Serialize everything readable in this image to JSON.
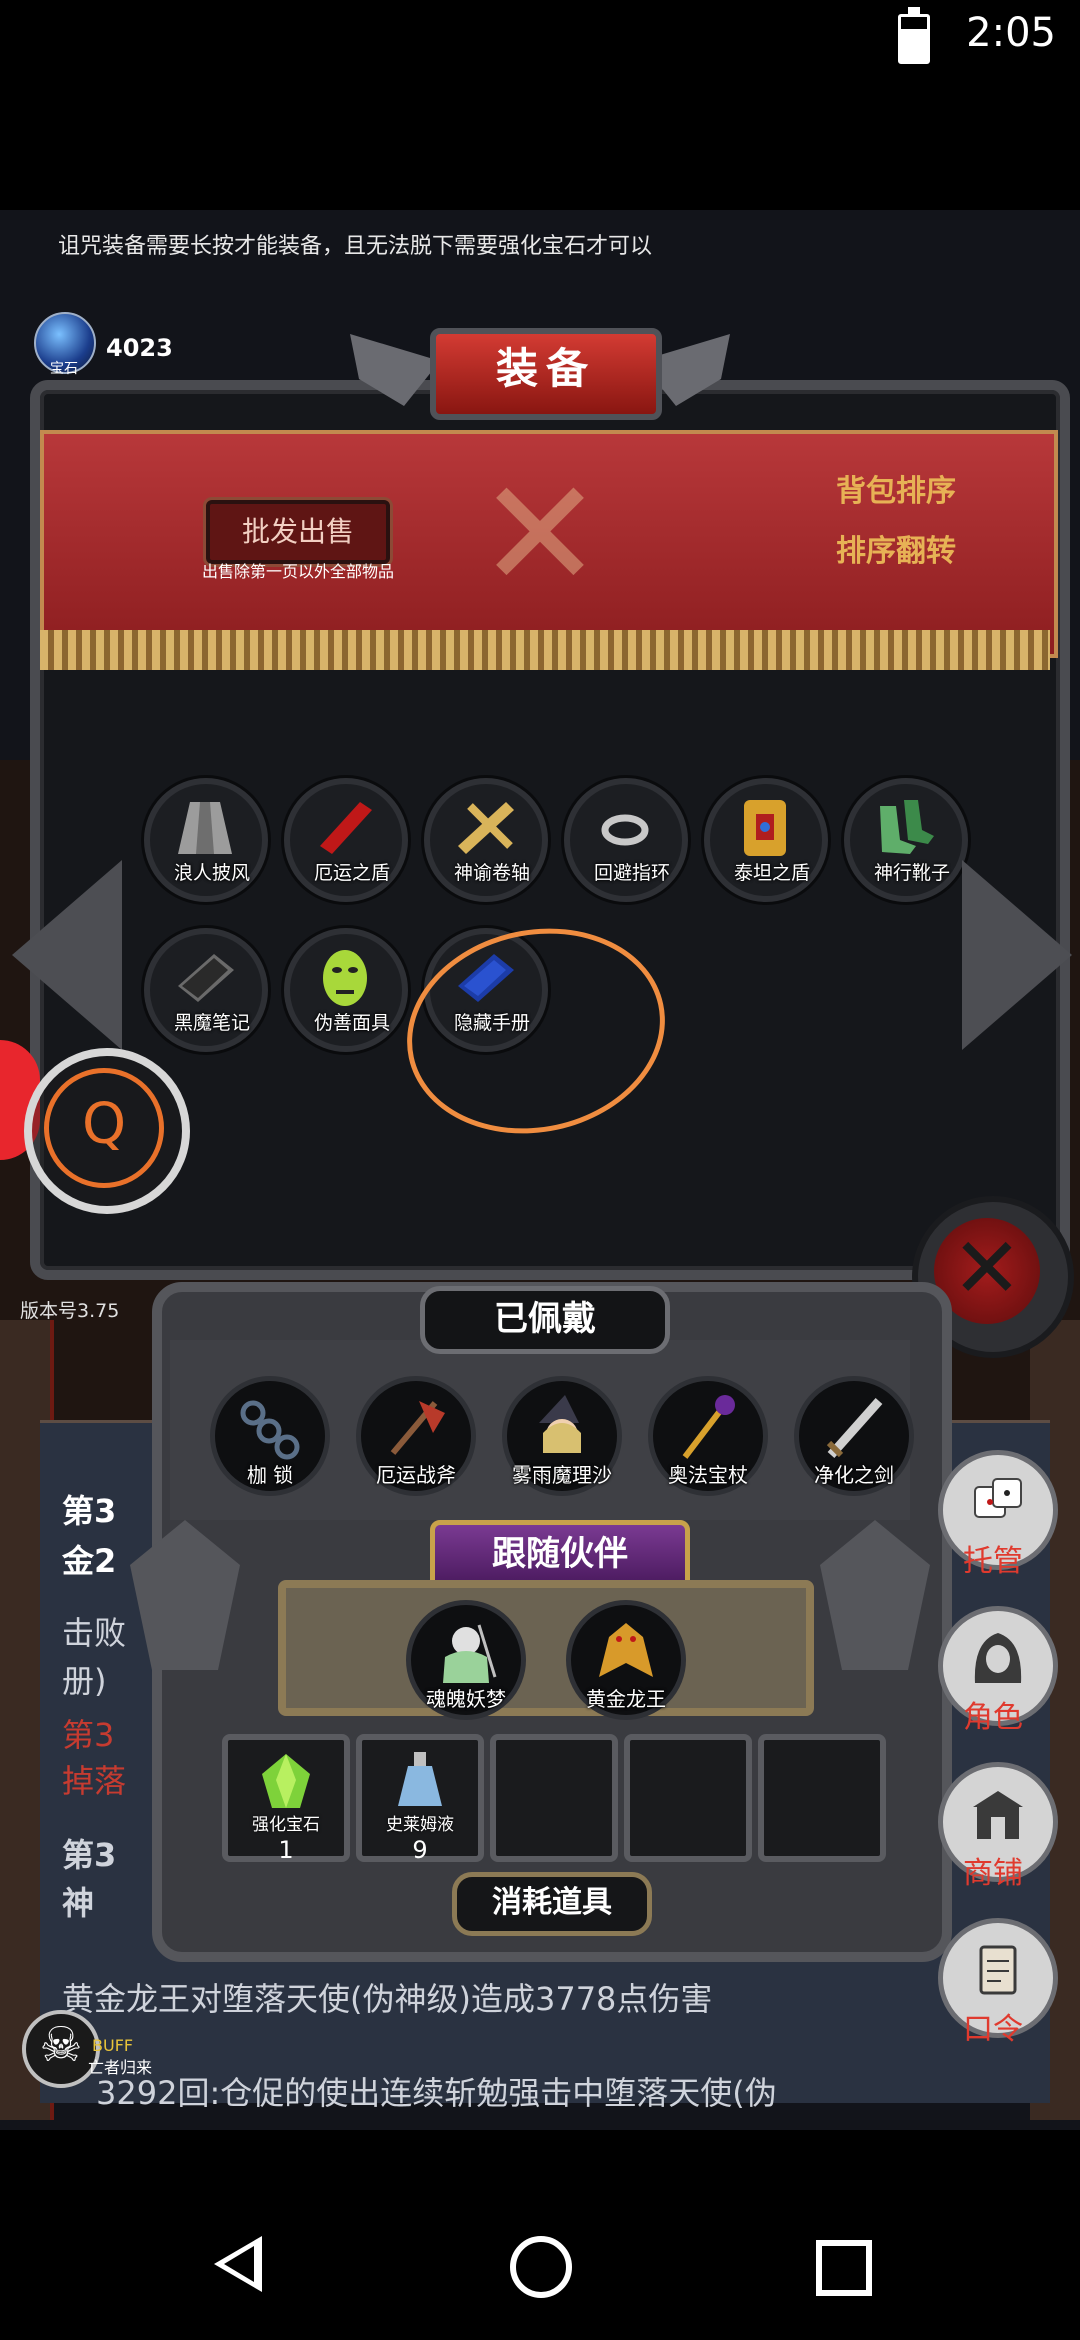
{
  "status_bar": {
    "time": "2:05",
    "battery_icon": "battery-icon"
  },
  "hint_text": "诅咒装备需要长按才能装备，且无法脱下需要强化宝石才可以",
  "currency": {
    "sub_label": "宝石",
    "count": "4023"
  },
  "equipment": {
    "title": "装备",
    "bulk_sell": "批发出售",
    "bulk_sell_note": "出售除第一页以外全部物品",
    "sort_bag": "背包排序",
    "sort_flip": "排序翻转",
    "items": [
      {
        "label": "浪人披风",
        "icon": "cloak-icon",
        "color": "#9c9c9c"
      },
      {
        "label": "厄运之盾",
        "icon": "red-shield-icon",
        "color": "#c01818"
      },
      {
        "label": "神谕卷轴",
        "icon": "scroll-icon",
        "color": "#d9b45a"
      },
      {
        "label": "回避指环",
        "icon": "ring-icon",
        "color": "#c8c8c8"
      },
      {
        "label": "泰坦之盾",
        "icon": "gold-shield-icon",
        "color": "#d8a12c"
      },
      {
        "label": "神行靴子",
        "icon": "boots-icon",
        "color": "#5fae6a"
      },
      {
        "label": "黑魔笔记",
        "icon": "black-book-icon",
        "color": "#6a6a6a"
      },
      {
        "label": "伪善面具",
        "icon": "mask-icon",
        "color": "#a8d83a"
      },
      {
        "label": "隐藏手册",
        "icon": "blue-book-icon",
        "color": "#1c3ca8"
      }
    ]
  },
  "left_float": {
    "q_label": "Q"
  },
  "version": "版本号3.75",
  "worn": {
    "title": "已佩戴",
    "items": [
      {
        "label": "枷 锁",
        "icon": "chains-icon",
        "color": "#5a6f88"
      },
      {
        "label": "厄运战斧",
        "icon": "axe-icon",
        "color": "#b83a2a"
      },
      {
        "label": "雾雨魔理沙",
        "icon": "witch-icon",
        "color": "#d8c070"
      },
      {
        "label": "奥法宝杖",
        "icon": "staff-icon",
        "color": "#d8a12c"
      },
      {
        "label": "净化之剑",
        "icon": "sword-icon",
        "color": "#d0d0d0"
      }
    ]
  },
  "follow": {
    "title": "跟随伙伴",
    "partners": [
      {
        "label": "魂魄妖梦",
        "icon": "youmu-icon",
        "color": "#9ad29a"
      },
      {
        "label": "黄金龙王",
        "icon": "gold-dragon-icon",
        "color": "#d89a2a"
      }
    ]
  },
  "consumables": {
    "title": "消耗道具",
    "items": [
      {
        "label": "强化宝石",
        "count": "1",
        "icon": "green-gem-icon",
        "color": "#7ed23a"
      },
      {
        "label": "史莱姆液",
        "count": "9",
        "icon": "potion-icon",
        "color": "#8ab8e0"
      }
    ]
  },
  "battle_log": {
    "line1a": "第3",
    "line1b": "金2",
    "line2a": "击败",
    "line2b": "册)",
    "line3a": "第3",
    "line3b": "掉落",
    "line4a": "第3",
    "line4b": "神",
    "line5": "黄金龙王对堕落天使(伪神级)造成3778点伤害",
    "line6": "3292回:仓促的使出连续斩勉强击中堕落天使(伪"
  },
  "side_buttons": [
    {
      "label": "托管",
      "icon": "dice-icon"
    },
    {
      "label": "角色",
      "icon": "hood-icon"
    },
    {
      "label": "商铺",
      "icon": "shop-icon"
    },
    {
      "label": "口令",
      "icon": "scroll-book-icon"
    }
  ],
  "buff": {
    "label": "BUFF",
    "sub": "亡者归来"
  },
  "nav": {
    "back": "back-icon",
    "home": "home-icon",
    "recent": "recent-icon"
  }
}
